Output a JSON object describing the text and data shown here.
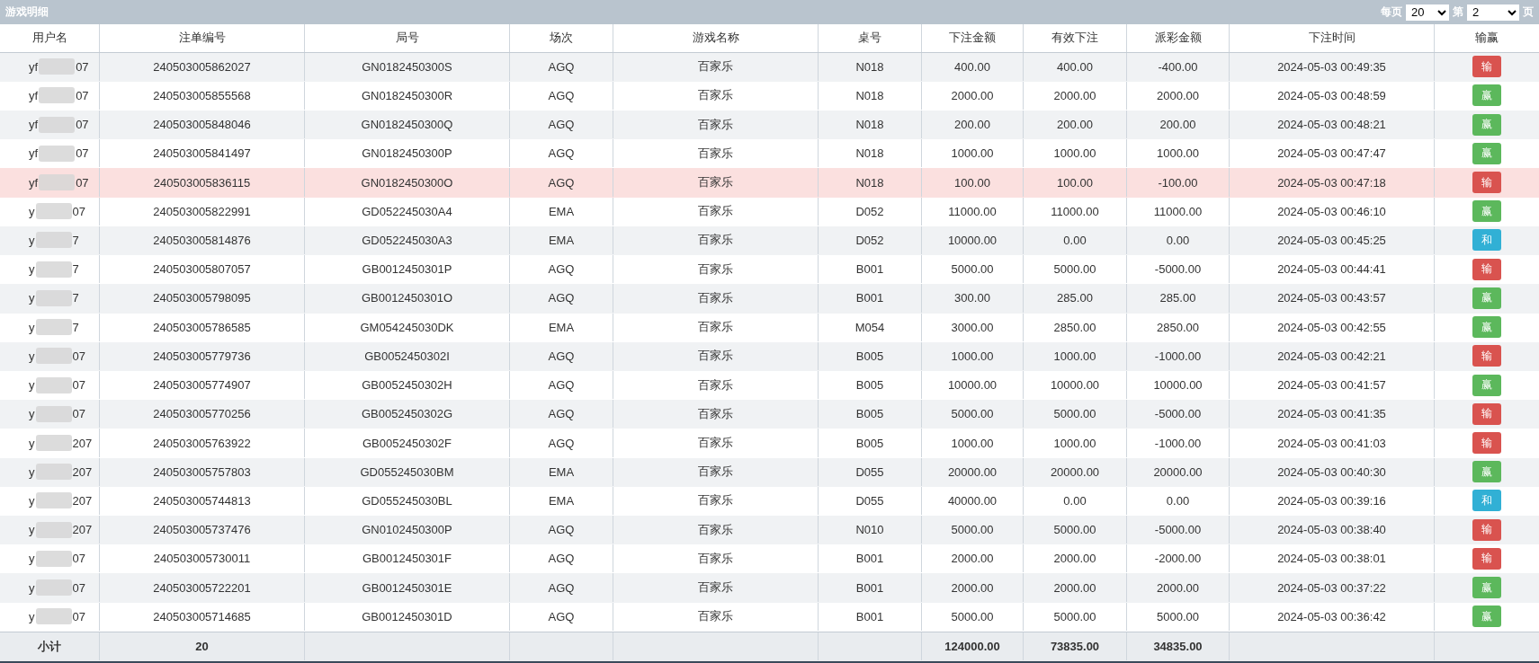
{
  "panel": {
    "title": "游戏明细",
    "pager": {
      "per_page_label": "每页",
      "per_page": "20",
      "page_label": "第",
      "page": "2",
      "page_suffix": "页"
    }
  },
  "table": {
    "columns": [
      "用户名",
      "注单编号",
      "局号",
      "场次",
      "游戏名称",
      "桌号",
      "下注金额",
      "有效下注",
      "派彩金额",
      "下注时间",
      "输赢"
    ],
    "rows": [
      {
        "user_start": "yf",
        "user_end": "07",
        "bet_id": "240503005862027",
        "round": "GN0182450300S",
        "venue": "AGQ",
        "game": "百家乐",
        "table": "N018",
        "bet": "400.00",
        "valid": "400.00",
        "payout": "-400.00",
        "time": "2024-05-03 00:49:35",
        "result": "输",
        "kind": "lose",
        "selected": false
      },
      {
        "user_start": "yf",
        "user_end": "07",
        "bet_id": "240503005855568",
        "round": "GN0182450300R",
        "venue": "AGQ",
        "game": "百家乐",
        "table": "N018",
        "bet": "2000.00",
        "valid": "2000.00",
        "payout": "2000.00",
        "time": "2024-05-03 00:48:59",
        "result": "赢",
        "kind": "win",
        "selected": false
      },
      {
        "user_start": "yf",
        "user_end": "07",
        "bet_id": "240503005848046",
        "round": "GN0182450300Q",
        "venue": "AGQ",
        "game": "百家乐",
        "table": "N018",
        "bet": "200.00",
        "valid": "200.00",
        "payout": "200.00",
        "time": "2024-05-03 00:48:21",
        "result": "赢",
        "kind": "win",
        "selected": false
      },
      {
        "user_start": "yf",
        "user_end": "07",
        "bet_id": "240503005841497",
        "round": "GN0182450300P",
        "venue": "AGQ",
        "game": "百家乐",
        "table": "N018",
        "bet": "1000.00",
        "valid": "1000.00",
        "payout": "1000.00",
        "time": "2024-05-03 00:47:47",
        "result": "赢",
        "kind": "win",
        "selected": false
      },
      {
        "user_start": "yf",
        "user_end": "07",
        "bet_id": "240503005836115",
        "round": "GN0182450300O",
        "venue": "AGQ",
        "game": "百家乐",
        "table": "N018",
        "bet": "100.00",
        "valid": "100.00",
        "payout": "-100.00",
        "time": "2024-05-03 00:47:18",
        "result": "输",
        "kind": "lose",
        "selected": true
      },
      {
        "user_start": "y",
        "user_end": "07",
        "bet_id": "240503005822991",
        "round": "GD052245030A4",
        "venue": "EMA",
        "game": "百家乐",
        "table": "D052",
        "bet": "11000.00",
        "valid": "11000.00",
        "payout": "11000.00",
        "time": "2024-05-03 00:46:10",
        "result": "赢",
        "kind": "win",
        "selected": false
      },
      {
        "user_start": "y",
        "user_end": "7",
        "bet_id": "240503005814876",
        "round": "GD052245030A3",
        "venue": "EMA",
        "game": "百家乐",
        "table": "D052",
        "bet": "10000.00",
        "valid": "0.00",
        "payout": "0.00",
        "time": "2024-05-03 00:45:25",
        "result": "和",
        "kind": "tie",
        "selected": false
      },
      {
        "user_start": "y",
        "user_end": "7",
        "bet_id": "240503005807057",
        "round": "GB0012450301P",
        "venue": "AGQ",
        "game": "百家乐",
        "table": "B001",
        "bet": "5000.00",
        "valid": "5000.00",
        "payout": "-5000.00",
        "time": "2024-05-03 00:44:41",
        "result": "输",
        "kind": "lose",
        "selected": false
      },
      {
        "user_start": "y",
        "user_end": "7",
        "bet_id": "240503005798095",
        "round": "GB0012450301O",
        "venue": "AGQ",
        "game": "百家乐",
        "table": "B001",
        "bet": "300.00",
        "valid": "285.00",
        "payout": "285.00",
        "time": "2024-05-03 00:43:57",
        "result": "赢",
        "kind": "win",
        "selected": false
      },
      {
        "user_start": "y",
        "user_end": "7",
        "bet_id": "240503005786585",
        "round": "GM054245030DK",
        "venue": "EMA",
        "game": "百家乐",
        "table": "M054",
        "bet": "3000.00",
        "valid": "2850.00",
        "payout": "2850.00",
        "time": "2024-05-03 00:42:55",
        "result": "赢",
        "kind": "win",
        "selected": false
      },
      {
        "user_start": "y",
        "user_end": "07",
        "bet_id": "240503005779736",
        "round": "GB0052450302I",
        "venue": "AGQ",
        "game": "百家乐",
        "table": "B005",
        "bet": "1000.00",
        "valid": "1000.00",
        "payout": "-1000.00",
        "time": "2024-05-03 00:42:21",
        "result": "输",
        "kind": "lose",
        "selected": false
      },
      {
        "user_start": "y",
        "user_end": "07",
        "bet_id": "240503005774907",
        "round": "GB0052450302H",
        "venue": "AGQ",
        "game": "百家乐",
        "table": "B005",
        "bet": "10000.00",
        "valid": "10000.00",
        "payout": "10000.00",
        "time": "2024-05-03 00:41:57",
        "result": "赢",
        "kind": "win",
        "selected": false
      },
      {
        "user_start": "y",
        "user_end": "07",
        "bet_id": "240503005770256",
        "round": "GB0052450302G",
        "venue": "AGQ",
        "game": "百家乐",
        "table": "B005",
        "bet": "5000.00",
        "valid": "5000.00",
        "payout": "-5000.00",
        "time": "2024-05-03 00:41:35",
        "result": "输",
        "kind": "lose",
        "selected": false
      },
      {
        "user_start": "y",
        "user_end": "207",
        "bet_id": "240503005763922",
        "round": "GB0052450302F",
        "venue": "AGQ",
        "game": "百家乐",
        "table": "B005",
        "bet": "1000.00",
        "valid": "1000.00",
        "payout": "-1000.00",
        "time": "2024-05-03 00:41:03",
        "result": "输",
        "kind": "lose",
        "selected": false
      },
      {
        "user_start": "y",
        "user_end": "207",
        "bet_id": "240503005757803",
        "round": "GD055245030BM",
        "venue": "EMA",
        "game": "百家乐",
        "table": "D055",
        "bet": "20000.00",
        "valid": "20000.00",
        "payout": "20000.00",
        "time": "2024-05-03 00:40:30",
        "result": "赢",
        "kind": "win",
        "selected": false
      },
      {
        "user_start": "y",
        "user_end": "207",
        "bet_id": "240503005744813",
        "round": "GD055245030BL",
        "venue": "EMA",
        "game": "百家乐",
        "table": "D055",
        "bet": "40000.00",
        "valid": "0.00",
        "payout": "0.00",
        "time": "2024-05-03 00:39:16",
        "result": "和",
        "kind": "tie",
        "selected": false
      },
      {
        "user_start": "y",
        "user_end": "207",
        "bet_id": "240503005737476",
        "round": "GN0102450300P",
        "venue": "AGQ",
        "game": "百家乐",
        "table": "N010",
        "bet": "5000.00",
        "valid": "5000.00",
        "payout": "-5000.00",
        "time": "2024-05-03 00:38:40",
        "result": "输",
        "kind": "lose",
        "selected": false
      },
      {
        "user_start": "y",
        "user_end": "07",
        "bet_id": "240503005730011",
        "round": "GB0012450301F",
        "venue": "AGQ",
        "game": "百家乐",
        "table": "B001",
        "bet": "2000.00",
        "valid": "2000.00",
        "payout": "-2000.00",
        "time": "2024-05-03 00:38:01",
        "result": "输",
        "kind": "lose",
        "selected": false
      },
      {
        "user_start": "y",
        "user_end": "07",
        "bet_id": "240503005722201",
        "round": "GB0012450301E",
        "venue": "AGQ",
        "game": "百家乐",
        "table": "B001",
        "bet": "2000.00",
        "valid": "2000.00",
        "payout": "2000.00",
        "time": "2024-05-03 00:37:22",
        "result": "赢",
        "kind": "win",
        "selected": false
      },
      {
        "user_start": "y",
        "user_end": "07",
        "bet_id": "240503005714685",
        "round": "GB0012450301D",
        "venue": "AGQ",
        "game": "百家乐",
        "table": "B001",
        "bet": "5000.00",
        "valid": "5000.00",
        "payout": "5000.00",
        "time": "2024-05-03 00:36:42",
        "result": "赢",
        "kind": "win",
        "selected": false
      }
    ],
    "footer": {
      "label": "小计",
      "count": "20",
      "bet_total": "124000.00",
      "valid_total": "73835.00",
      "payout_total": "34835.00"
    }
  }
}
